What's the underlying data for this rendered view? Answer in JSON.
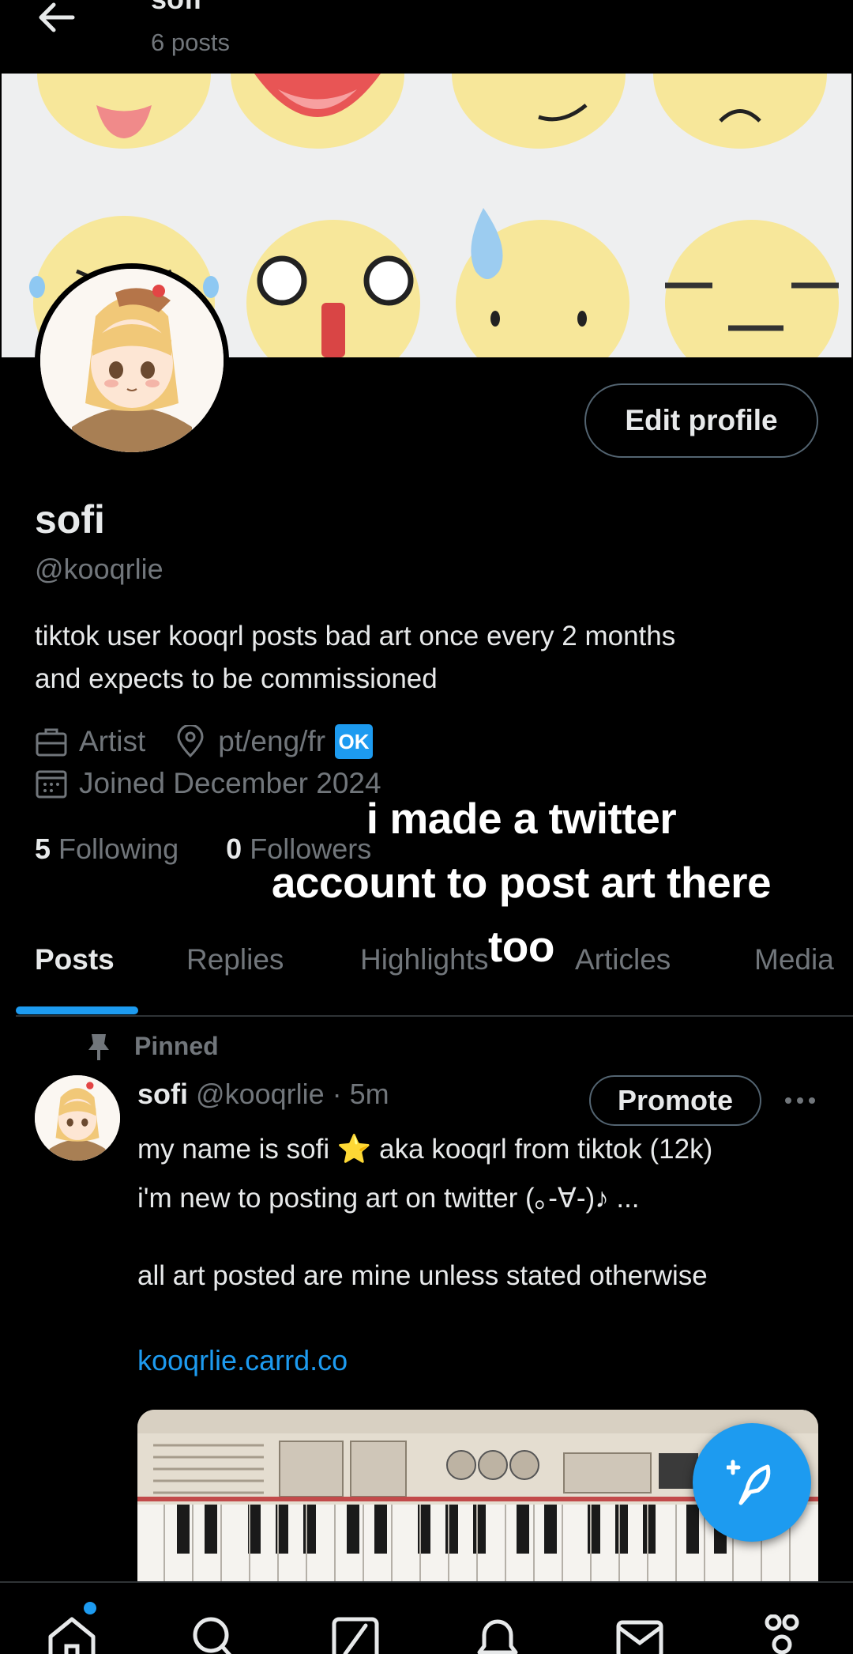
{
  "header": {
    "name": "sofi",
    "post_count": "6 posts"
  },
  "profile": {
    "edit_label": "Edit profile",
    "display_name": "sofi",
    "handle": "@kooqrlie",
    "bio_line1": "tiktok user kooqrl posts bad art once every 2 months",
    "bio_line2": "and expects to be commissioned",
    "category": "Artist",
    "location": "pt/eng/fr",
    "location_badge": "OK",
    "joined": "Joined December 2024",
    "following_count": "5",
    "following_label": "Following",
    "followers_count": "0",
    "followers_label": "Followers"
  },
  "caption": {
    "line1": "i made   a twitter",
    "line2": "account to post art there",
    "line3": "too"
  },
  "tabs": [
    {
      "label": "Posts"
    },
    {
      "label": "Replies"
    },
    {
      "label": "Highlights"
    },
    {
      "label": "Articles"
    },
    {
      "label": "Media"
    }
  ],
  "post": {
    "pinned_label": "Pinned",
    "author_name": "sofi",
    "author_meta": "@kooqrlie · 5m",
    "promote_label": "Promote",
    "line1_a": "my name is sofi ",
    "line1_emoji": "⭐",
    "line1_b": " aka kooqrl from tiktok (12k)",
    "line2": "i'm new to posting art on twitter (｡-∀-)♪ ...",
    "line3": "all art posted are mine unless stated otherwise",
    "link": "kooqrlie.carrd.co"
  },
  "colors": {
    "accent": "#1d9bf0",
    "background": "#000000",
    "primary_text": "#e7e9ea",
    "secondary_text": "#71767b"
  },
  "icons": {
    "back": "arrow-left-icon",
    "category": "briefcase-icon",
    "location": "map-pin-icon",
    "joined": "calendar-icon",
    "pinned": "pin-icon",
    "more": "more-dots-icon",
    "compose": "compose-feather-icon",
    "nav": [
      "home-icon",
      "search-icon",
      "grok-icon",
      "notifications-icon",
      "messages-icon",
      "communities-icon"
    ]
  }
}
